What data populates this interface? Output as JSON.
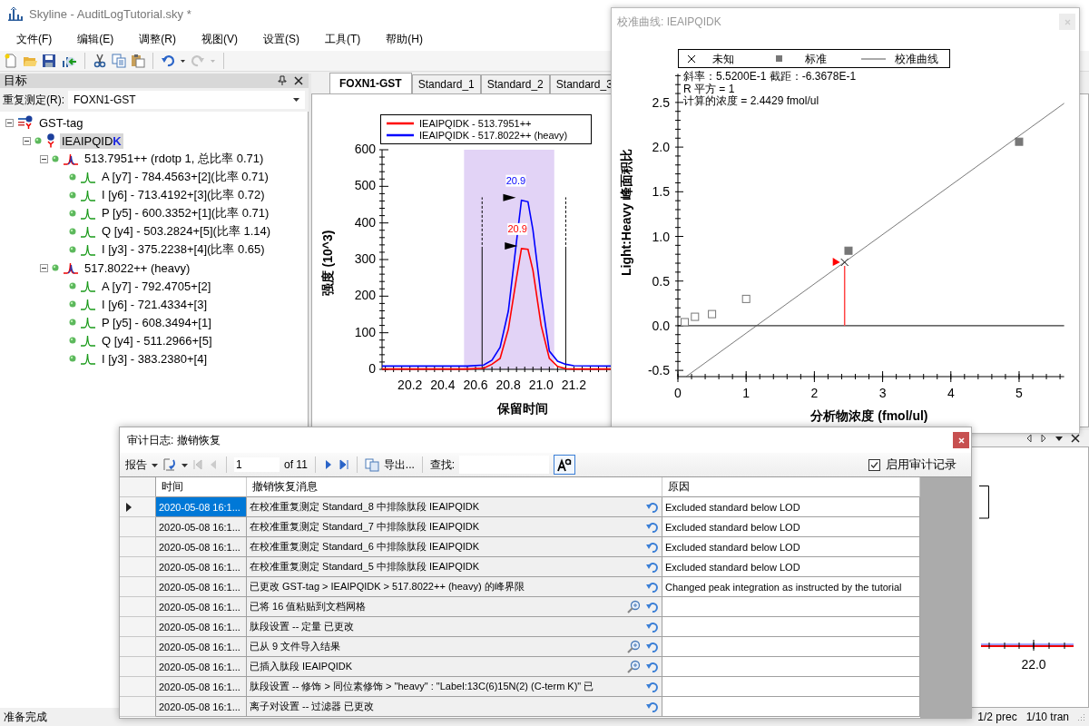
{
  "window": {
    "title": "Skyline - AuditLogTutorial.sky *"
  },
  "menu": [
    "文件(F)",
    "编辑(E)",
    "调整(R)",
    "视图(V)",
    "设置(S)",
    "工具(T)",
    "帮助(H)"
  ],
  "toolbar": {
    "undo_enabled": true,
    "redo_enabled": false
  },
  "targets_panel": {
    "title": "目标",
    "replicate_label": "重复测定(R):",
    "replicate_value": "FOXN1-GST",
    "tree": [
      {
        "kind": "protein",
        "label": "GST-tag",
        "selected": false,
        "expanded": true,
        "children": [
          {
            "kind": "peptide",
            "label": "IEAIPQID**K**",
            "selected": true,
            "expanded": true,
            "children": [
              {
                "kind": "precursor",
                "label": "513.7951++ (rdotp 1, 总比率 0.71)",
                "selected": false,
                "expanded": true,
                "children": [
                  {
                    "kind": "transition",
                    "label": "A [y7] - 784.4563+[2](比率 0.71)",
                    "selected": false
                  },
                  {
                    "kind": "transition",
                    "label": "I [y6] - 713.4192+[3](比率 0.72)",
                    "selected": false
                  },
                  {
                    "kind": "transition",
                    "label": "P [y5] - 600.3352+[1](比率 0.71)",
                    "selected": false
                  },
                  {
                    "kind": "transition",
                    "label": "Q [y4] - 503.2824+[5](比率 1.14)",
                    "selected": false
                  },
                  {
                    "kind": "transition",
                    "label": "I [y3] - 375.2238+[4](比率 0.65)",
                    "selected": false
                  }
                ]
              },
              {
                "kind": "precursor",
                "label": "517.8022++ (heavy)",
                "selected": false,
                "expanded": true,
                "children": [
                  {
                    "kind": "transition",
                    "label": "A [y7] - 792.4705+[2]",
                    "selected": false
                  },
                  {
                    "kind": "transition",
                    "label": "I [y6] - 721.4334+[3]",
                    "selected": false
                  },
                  {
                    "kind": "transition",
                    "label": "P [y5] - 608.3494+[1]",
                    "selected": false
                  },
                  {
                    "kind": "transition",
                    "label": "Q [y4] - 511.2966+[5]",
                    "selected": false
                  },
                  {
                    "kind": "transition",
                    "label": "I [y3] - 383.2380+[4]",
                    "selected": false
                  }
                ]
              }
            ]
          }
        ]
      }
    ]
  },
  "tabs": [
    {
      "label": "FOXN1-GST",
      "selected": true
    },
    {
      "label": "Standard_1",
      "selected": false
    },
    {
      "label": "Standard_2",
      "selected": false
    },
    {
      "label": "Standard_3",
      "selected": false
    }
  ],
  "chromatogram": {
    "chart_data": {
      "type": "line",
      "xlabel": "保留时间",
      "ylabel": "强度 (10^3)",
      "legend": "top",
      "x": [
        20.03,
        20.2,
        20.4,
        20.55,
        20.65,
        20.7,
        20.75,
        20.8,
        20.85,
        20.88,
        20.92,
        20.95,
        21.0,
        21.05,
        21.1,
        21.15,
        21.2,
        21.43
      ],
      "series": [
        {
          "name": "IEAIPQIDK - 513.7951++",
          "color": "#ff0000",
          "values": [
            1,
            1,
            1,
            1,
            3,
            14,
            30,
            110,
            250,
            330,
            328,
            270,
            120,
            30,
            8,
            2,
            1,
            1
          ]
        },
        {
          "name": "IEAIPQIDK - 517.8022++ (heavy)",
          "color": "#0000ff",
          "values": [
            9,
            9,
            9,
            9,
            12,
            25,
            60,
            160,
            350,
            462,
            458,
            380,
            200,
            50,
            22,
            14,
            10,
            9
          ]
        }
      ],
      "xlim": [
        20.03,
        21.43
      ],
      "ylim": [
        0,
        600
      ],
      "xticks": [
        20.2,
        20.4,
        20.6,
        20.8,
        {
          "value": 21,
          "label": "21.0"
        },
        21.2
      ],
      "yticks": [
        0,
        100,
        200,
        300,
        400,
        500,
        600
      ],
      "bands": [
        {
          "axis": "x",
          "from": 20.53,
          "to": 21.08
        }
      ],
      "ref_lines": [
        {
          "axis": "x",
          "value": 20.64
        },
        {
          "axis": "x",
          "value": 21.15
        }
      ],
      "annotations": [
        {
          "x": 20.89,
          "y": 462,
          "text": "20.9"
        },
        {
          "x": 20.9,
          "y": 330,
          "text": "20.9"
        }
      ]
    }
  },
  "lower_pane": {
    "tick_label": "22.0"
  },
  "calibration_window": {
    "title": "校准曲线: IEAIPQIDK",
    "active": false,
    "chart_data": {
      "type": "scatter",
      "xlabel": "分析物浓度 (fmol/ul)",
      "ylabel": "Light:Heavy 峰面积比",
      "legend": "top",
      "series": [
        {
          "name": "未知",
          "type": "scatter",
          "marker": "cross",
          "color": "#000000",
          "x": [
            2.4429
          ],
          "values": [
            0.71
          ]
        },
        {
          "name": "标准",
          "type": "scatter",
          "marker": "square",
          "color": "#777777",
          "x": [
            2.5,
            5
          ],
          "values": [
            0.84,
            2.06
          ]
        },
        {
          "type": "scatter",
          "marker": "square",
          "color": "#ffffff",
          "x": [
            0.1,
            0.25,
            0.5,
            1
          ],
          "values": [
            0.04,
            0.1,
            0.13,
            0.3
          ]
        },
        {
          "name": "校准曲线",
          "type": "line",
          "color": "#555555",
          "x": [
            0.12,
            5.66
          ],
          "values": [
            -0.57,
            2.49
          ]
        }
      ],
      "xlim": [
        0,
        5.66
      ],
      "ylim": [
        -0.57,
        2.82
      ],
      "xticks": [
        0,
        1,
        2,
        3,
        4,
        5
      ],
      "yticks": [
        {
          "value": -0.5,
          "label": "-0.5"
        },
        {
          "value": 0,
          "label": "0.0"
        },
        {
          "value": 0.5,
          "label": "0.5"
        },
        {
          "value": 1,
          "label": "1.0"
        },
        {
          "value": 1.5,
          "label": "1.5"
        },
        {
          "value": 2,
          "label": "2.0"
        },
        {
          "value": 2.5,
          "label": "2.5"
        }
      ],
      "annotations": [
        "斜率：5.5200E-1 截距：-6.3678E-1",
        "R 平方 = 1",
        "计算的浓度 = 2.4429 fmol/ul"
      ]
    }
  },
  "audit_log": {
    "title": "审计日志: 撤销恢复",
    "active": true,
    "toolbar": {
      "report": "报告",
      "page": "1",
      "page_count": "of 11",
      "export": "导出...",
      "find": "查找:",
      "font_toggle_on": true,
      "enable_label": "启用审计记录",
      "enable_checked": true
    },
    "columns": [
      "时间",
      "撤销恢复消息",
      "原因"
    ],
    "rows": [
      {
        "time": "2020-05-08 16:1...",
        "message": "在校准重复测定 Standard_8 中排除肽段 IEAIPQIDK",
        "reason": "Excluded standard below LOD",
        "details": false,
        "selected": true
      },
      {
        "time": "2020-05-08 16:1...",
        "message": "在校准重复测定 Standard_7 中排除肽段 IEAIPQIDK",
        "reason": "Excluded standard below LOD",
        "details": false,
        "selected": false
      },
      {
        "time": "2020-05-08 16:1...",
        "message": "在校准重复测定 Standard_6 中排除肽段 IEAIPQIDK",
        "reason": "Excluded standard below LOD",
        "details": false,
        "selected": false
      },
      {
        "time": "2020-05-08 16:1...",
        "message": "在校准重复测定 Standard_5 中排除肽段 IEAIPQIDK",
        "reason": "Excluded standard below LOD",
        "details": false,
        "selected": false
      },
      {
        "time": "2020-05-08 16:1...",
        "message": "已更改 GST-tag > IEAIPQIDK > 517.8022++ (heavy) 的峰界限",
        "reason": "Changed peak integration as instructed by the tutorial",
        "details": false,
        "selected": false
      },
      {
        "time": "2020-05-08 16:1...",
        "message": "已将 16 值粘贴到文档网格",
        "details": true,
        "selected": false
      },
      {
        "time": "2020-05-08 16:1...",
        "message": "肽段设置 -- 定量 已更改",
        "details": false,
        "selected": false
      },
      {
        "time": "2020-05-08 16:1...",
        "message": "已从 9 文件导入结果",
        "details": true,
        "selected": false
      },
      {
        "time": "2020-05-08 16:1...",
        "message": "已插入肽段 IEAIPQIDK",
        "details": true,
        "selected": false
      },
      {
        "time": "2020-05-08 16:1...",
        "message": "肽段设置 -- 修饰 > 同位素修饰 > \"heavy\" : \"Label:13C(6)15N(2) (C-term K)\" 已",
        "details": false,
        "selected": false
      },
      {
        "time": "2020-05-08 16:1...",
        "message": "离子对设置 -- 过滤器 已更改",
        "details": false,
        "selected": false
      }
    ]
  },
  "status_bar": {
    "message": "准备完成",
    "counts": [
      "1/2 prec",
      "1/10 tran"
    ]
  }
}
